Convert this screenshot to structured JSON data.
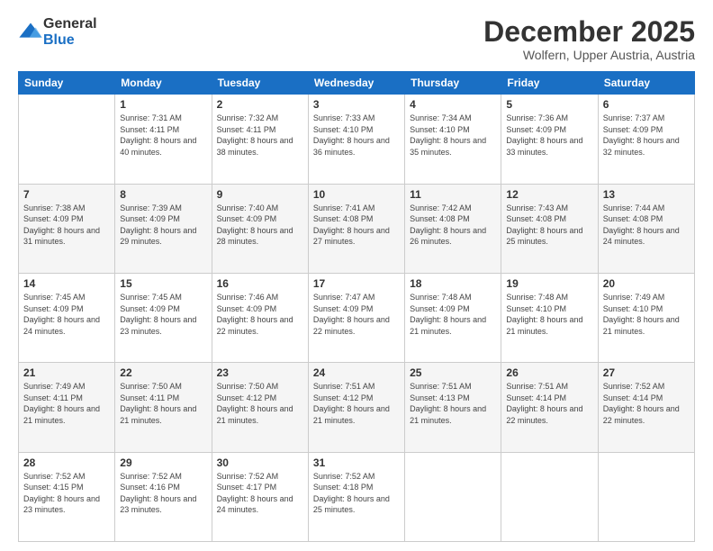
{
  "header": {
    "logo": {
      "general": "General",
      "blue": "Blue"
    },
    "month_title": "December 2025",
    "location": "Wolfern, Upper Austria, Austria"
  },
  "weekdays": [
    "Sunday",
    "Monday",
    "Tuesday",
    "Wednesday",
    "Thursday",
    "Friday",
    "Saturday"
  ],
  "weeks": [
    [
      {
        "day": "",
        "sunrise": "",
        "sunset": "",
        "daylight": ""
      },
      {
        "day": "1",
        "sunrise": "Sunrise: 7:31 AM",
        "sunset": "Sunset: 4:11 PM",
        "daylight": "Daylight: 8 hours and 40 minutes."
      },
      {
        "day": "2",
        "sunrise": "Sunrise: 7:32 AM",
        "sunset": "Sunset: 4:11 PM",
        "daylight": "Daylight: 8 hours and 38 minutes."
      },
      {
        "day": "3",
        "sunrise": "Sunrise: 7:33 AM",
        "sunset": "Sunset: 4:10 PM",
        "daylight": "Daylight: 8 hours and 36 minutes."
      },
      {
        "day": "4",
        "sunrise": "Sunrise: 7:34 AM",
        "sunset": "Sunset: 4:10 PM",
        "daylight": "Daylight: 8 hours and 35 minutes."
      },
      {
        "day": "5",
        "sunrise": "Sunrise: 7:36 AM",
        "sunset": "Sunset: 4:09 PM",
        "daylight": "Daylight: 8 hours and 33 minutes."
      },
      {
        "day": "6",
        "sunrise": "Sunrise: 7:37 AM",
        "sunset": "Sunset: 4:09 PM",
        "daylight": "Daylight: 8 hours and 32 minutes."
      }
    ],
    [
      {
        "day": "7",
        "sunrise": "Sunrise: 7:38 AM",
        "sunset": "Sunset: 4:09 PM",
        "daylight": "Daylight: 8 hours and 31 minutes."
      },
      {
        "day": "8",
        "sunrise": "Sunrise: 7:39 AM",
        "sunset": "Sunset: 4:09 PM",
        "daylight": "Daylight: 8 hours and 29 minutes."
      },
      {
        "day": "9",
        "sunrise": "Sunrise: 7:40 AM",
        "sunset": "Sunset: 4:09 PM",
        "daylight": "Daylight: 8 hours and 28 minutes."
      },
      {
        "day": "10",
        "sunrise": "Sunrise: 7:41 AM",
        "sunset": "Sunset: 4:08 PM",
        "daylight": "Daylight: 8 hours and 27 minutes."
      },
      {
        "day": "11",
        "sunrise": "Sunrise: 7:42 AM",
        "sunset": "Sunset: 4:08 PM",
        "daylight": "Daylight: 8 hours and 26 minutes."
      },
      {
        "day": "12",
        "sunrise": "Sunrise: 7:43 AM",
        "sunset": "Sunset: 4:08 PM",
        "daylight": "Daylight: 8 hours and 25 minutes."
      },
      {
        "day": "13",
        "sunrise": "Sunrise: 7:44 AM",
        "sunset": "Sunset: 4:08 PM",
        "daylight": "Daylight: 8 hours and 24 minutes."
      }
    ],
    [
      {
        "day": "14",
        "sunrise": "Sunrise: 7:45 AM",
        "sunset": "Sunset: 4:09 PM",
        "daylight": "Daylight: 8 hours and 24 minutes."
      },
      {
        "day": "15",
        "sunrise": "Sunrise: 7:45 AM",
        "sunset": "Sunset: 4:09 PM",
        "daylight": "Daylight: 8 hours and 23 minutes."
      },
      {
        "day": "16",
        "sunrise": "Sunrise: 7:46 AM",
        "sunset": "Sunset: 4:09 PM",
        "daylight": "Daylight: 8 hours and 22 minutes."
      },
      {
        "day": "17",
        "sunrise": "Sunrise: 7:47 AM",
        "sunset": "Sunset: 4:09 PM",
        "daylight": "Daylight: 8 hours and 22 minutes."
      },
      {
        "day": "18",
        "sunrise": "Sunrise: 7:48 AM",
        "sunset": "Sunset: 4:09 PM",
        "daylight": "Daylight: 8 hours and 21 minutes."
      },
      {
        "day": "19",
        "sunrise": "Sunrise: 7:48 AM",
        "sunset": "Sunset: 4:10 PM",
        "daylight": "Daylight: 8 hours and 21 minutes."
      },
      {
        "day": "20",
        "sunrise": "Sunrise: 7:49 AM",
        "sunset": "Sunset: 4:10 PM",
        "daylight": "Daylight: 8 hours and 21 minutes."
      }
    ],
    [
      {
        "day": "21",
        "sunrise": "Sunrise: 7:49 AM",
        "sunset": "Sunset: 4:11 PM",
        "daylight": "Daylight: 8 hours and 21 minutes."
      },
      {
        "day": "22",
        "sunrise": "Sunrise: 7:50 AM",
        "sunset": "Sunset: 4:11 PM",
        "daylight": "Daylight: 8 hours and 21 minutes."
      },
      {
        "day": "23",
        "sunrise": "Sunrise: 7:50 AM",
        "sunset": "Sunset: 4:12 PM",
        "daylight": "Daylight: 8 hours and 21 minutes."
      },
      {
        "day": "24",
        "sunrise": "Sunrise: 7:51 AM",
        "sunset": "Sunset: 4:12 PM",
        "daylight": "Daylight: 8 hours and 21 minutes."
      },
      {
        "day": "25",
        "sunrise": "Sunrise: 7:51 AM",
        "sunset": "Sunset: 4:13 PM",
        "daylight": "Daylight: 8 hours and 21 minutes."
      },
      {
        "day": "26",
        "sunrise": "Sunrise: 7:51 AM",
        "sunset": "Sunset: 4:14 PM",
        "daylight": "Daylight: 8 hours and 22 minutes."
      },
      {
        "day": "27",
        "sunrise": "Sunrise: 7:52 AM",
        "sunset": "Sunset: 4:14 PM",
        "daylight": "Daylight: 8 hours and 22 minutes."
      }
    ],
    [
      {
        "day": "28",
        "sunrise": "Sunrise: 7:52 AM",
        "sunset": "Sunset: 4:15 PM",
        "daylight": "Daylight: 8 hours and 23 minutes."
      },
      {
        "day": "29",
        "sunrise": "Sunrise: 7:52 AM",
        "sunset": "Sunset: 4:16 PM",
        "daylight": "Daylight: 8 hours and 23 minutes."
      },
      {
        "day": "30",
        "sunrise": "Sunrise: 7:52 AM",
        "sunset": "Sunset: 4:17 PM",
        "daylight": "Daylight: 8 hours and 24 minutes."
      },
      {
        "day": "31",
        "sunrise": "Sunrise: 7:52 AM",
        "sunset": "Sunset: 4:18 PM",
        "daylight": "Daylight: 8 hours and 25 minutes."
      },
      {
        "day": "",
        "sunrise": "",
        "sunset": "",
        "daylight": ""
      },
      {
        "day": "",
        "sunrise": "",
        "sunset": "",
        "daylight": ""
      },
      {
        "day": "",
        "sunrise": "",
        "sunset": "",
        "daylight": ""
      }
    ]
  ]
}
